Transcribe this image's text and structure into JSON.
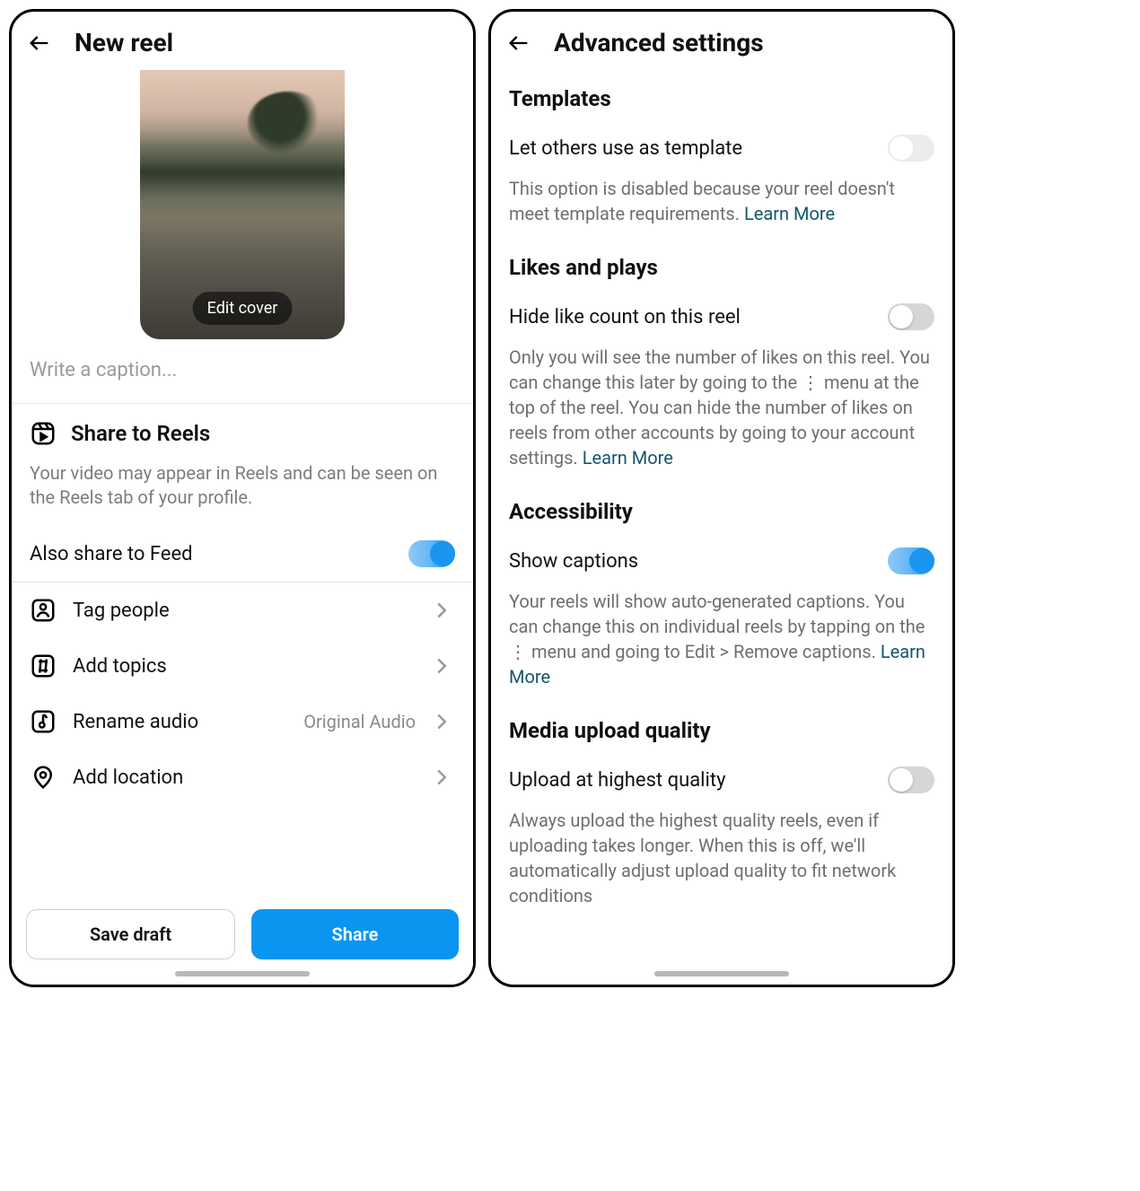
{
  "left": {
    "title": "New reel",
    "edit_cover": "Edit cover",
    "caption_placeholder": "Write a caption...",
    "share_reels": {
      "title": "Share to Reels",
      "helper": "Your video may appear in Reels and can be seen on the Reels tab of your profile.",
      "also_feed_label": "Also share to Feed",
      "also_feed_on": true
    },
    "rows": {
      "tag_people": "Tag people",
      "add_topics": "Add topics",
      "rename_audio": "Rename audio",
      "rename_audio_value": "Original Audio",
      "add_location": "Add location"
    },
    "buttons": {
      "save_draft": "Save draft",
      "share": "Share"
    }
  },
  "right": {
    "title": "Advanced settings",
    "templates": {
      "heading": "Templates",
      "row_label": "Let others use as template",
      "desc": "This option is disabled because your reel doesn't meet template requirements. ",
      "learn": "Learn More"
    },
    "likes": {
      "heading": "Likes and plays",
      "row_label": "Hide like count on this reel",
      "desc": "Only you will see the number of likes on this reel. You can change this later by going to the ⋮ menu at the top of the reel. You can hide the number of likes on reels from other accounts by going to your account settings. ",
      "learn": "Learn More"
    },
    "accessibility": {
      "heading": "Accessibility",
      "row_label": "Show captions",
      "desc": "Your reels will show auto-generated captions. You can change this on individual reels by tapping on the ⋮ menu and going to Edit > Remove captions. ",
      "learn": "Learn More"
    },
    "media": {
      "heading": "Media upload quality",
      "row_label": "Upload at highest quality",
      "desc": "Always upload the highest quality reels, even if uploading takes longer. When this is off, we'll automatically adjust upload quality to fit network conditions"
    }
  }
}
